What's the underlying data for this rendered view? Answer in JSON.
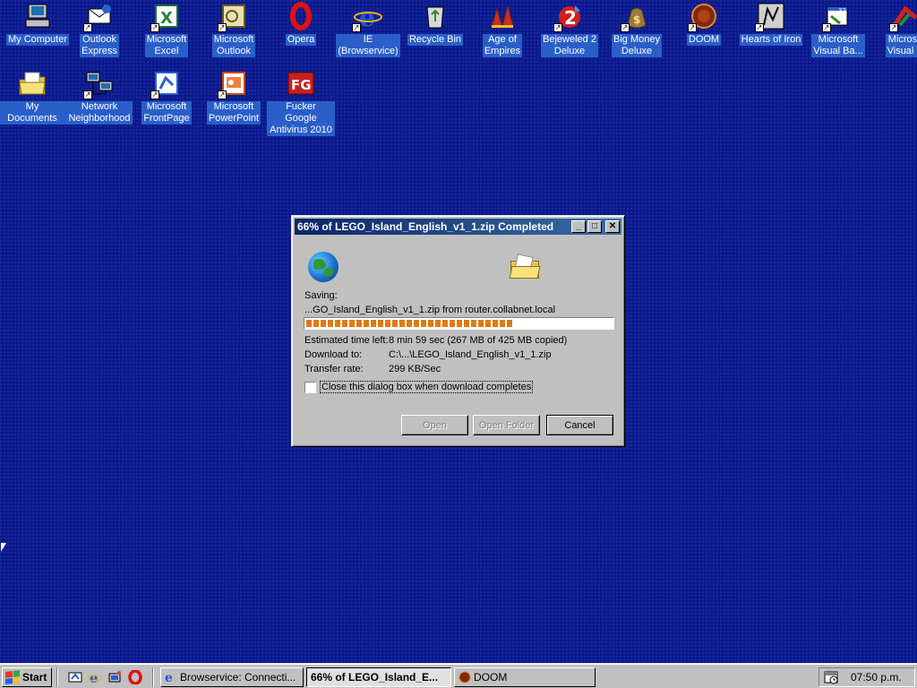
{
  "desktop": {
    "icons": [
      {
        "label": "My Computer",
        "icon": "my-computer-icon"
      },
      {
        "label": "Outlook\nExpress",
        "icon": "outlook-express-icon"
      },
      {
        "label": "Microsoft\nExcel",
        "icon": "excel-icon"
      },
      {
        "label": "Microsoft\nOutlook",
        "icon": "outlook-icon"
      },
      {
        "label": "Opera",
        "icon": "opera-icon"
      },
      {
        "label": "IE\n(Browservice)",
        "icon": "ie-icon"
      },
      {
        "label": "Recycle Bin",
        "icon": "recycle-bin-icon"
      },
      {
        "label": "Age of\nEmpires",
        "icon": "age-of-empires-icon"
      },
      {
        "label": "Bejeweled 2\nDeluxe",
        "icon": "bejeweled-icon"
      },
      {
        "label": "Big Money\nDeluxe",
        "icon": "big-money-icon"
      },
      {
        "label": "DOOM",
        "icon": "doom-icon"
      },
      {
        "label": "Hearts of Iron",
        "icon": "hearts-of-iron-icon"
      },
      {
        "label": "Microsoft\nVisual Ba...",
        "icon": "visual-basic-icon"
      },
      {
        "label": "Microso\nVisual C",
        "icon": "visual-c-icon"
      },
      {
        "label": "My Documents",
        "icon": "my-documents-icon"
      },
      {
        "label": "Network\nNeighborhood",
        "icon": "network-neighborhood-icon"
      },
      {
        "label": "Microsoft\nFrontPage",
        "icon": "frontpage-icon"
      },
      {
        "label": "Microsoft\nPowerPoint",
        "icon": "powerpoint-icon"
      },
      {
        "label": "Fucker Google\nAntivirus 2010",
        "icon": "antivirus-icon"
      }
    ]
  },
  "dialog": {
    "title": "66% of LEGO_Island_English_v1_1.zip Completed",
    "saving_label": "Saving:",
    "saving_file": "...GO_Island_English_v1_1.zip from router.collabnet.local",
    "progress_fraction": 0.68,
    "time_left_label": "Estimated time left:",
    "time_left_value": "8 min 59 sec (267 MB of 425 MB copied)",
    "download_to_label": "Download to:",
    "download_to_value": "C:\\...\\LEGO_Island_English_v1_1.zip",
    "transfer_rate_label": "Transfer rate:",
    "transfer_rate_value": "299 KB/Sec",
    "close_checkbox_label": "Close this dialog box when download completes",
    "close_checkbox_checked": false,
    "open_button": "Open",
    "open_folder_button": "Open Folder",
    "cancel_button": "Cancel",
    "titlebar_buttons": {
      "minimize": "_",
      "maximize": "□",
      "close": "✕"
    }
  },
  "taskbar": {
    "start_label": "Start",
    "quick_launch": [
      "show-desktop-icon",
      "ie-icon",
      "channels-icon",
      "opera-icon"
    ],
    "tasks": [
      {
        "label": "Browservice: Connecti...",
        "active": false
      },
      {
        "label": "66% of LEGO_Island_E...",
        "active": true
      },
      {
        "label": "DOOM",
        "active": false
      }
    ],
    "clock": "07:50 p.m."
  },
  "colors": {
    "desktop": "#0c1a8c",
    "title_active": "#0a246a",
    "progress": "#e07a10",
    "icon_label_bg": "#2a5fc9"
  }
}
